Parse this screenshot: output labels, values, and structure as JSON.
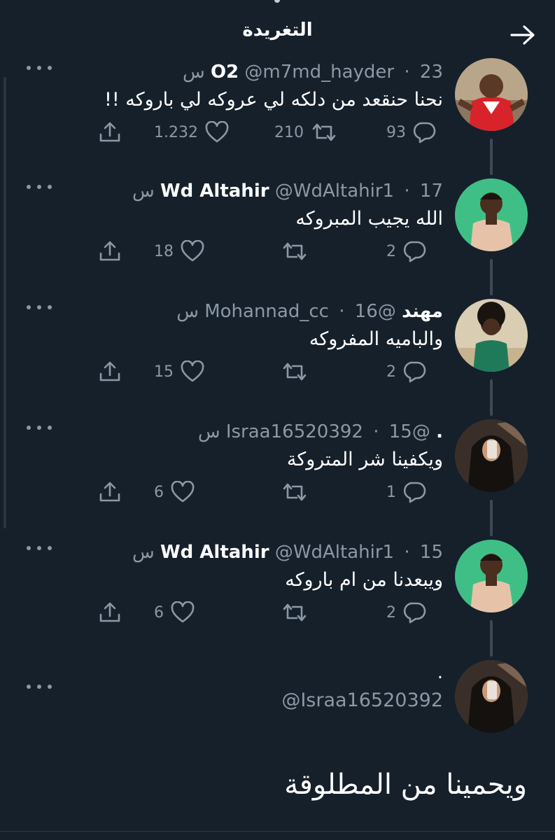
{
  "header": {
    "title": "التغريدة",
    "back_icon": "arrow-right-icon"
  },
  "colors": {
    "background": "#15202b",
    "secondary_text": "#8b98a5",
    "primary_text": "#ffffff"
  },
  "tweets": [
    {
      "name": "O2",
      "handle": "@m7md_hayder",
      "time": "23 س",
      "text": "نحنا حنقعد من دلكه لي عروكه لي باروكه !!",
      "replies": "93",
      "retweets": "210",
      "likes": "1.232"
    },
    {
      "name": "Wd Altahir",
      "handle": "@WdAltahir1",
      "time": "17 س",
      "text": "الله يجيب المبروكه",
      "replies": "2",
      "retweets": "",
      "likes": "18"
    },
    {
      "name": "مهند",
      "handle": "@Mohannad_cc",
      "time": "16 س",
      "text": "والباميه المفروكه",
      "replies": "2",
      "retweets": "",
      "likes": "15"
    },
    {
      "name": ".",
      "handle": "@Israa16520392",
      "time": "15 س",
      "text": "ويكفينا شر المتروكة",
      "replies": "1",
      "retweets": "",
      "likes": "6"
    },
    {
      "name": "Wd Altahir",
      "handle": "@WdAltahir1",
      "time": "15 س",
      "text": "ويبعدنا من ام باروكه",
      "replies": "2",
      "retweets": "",
      "likes": "6"
    }
  ],
  "main_tweet": {
    "name": ".",
    "handle": "@Israa16520392",
    "text": "ويحمينا من المطلوقة"
  }
}
